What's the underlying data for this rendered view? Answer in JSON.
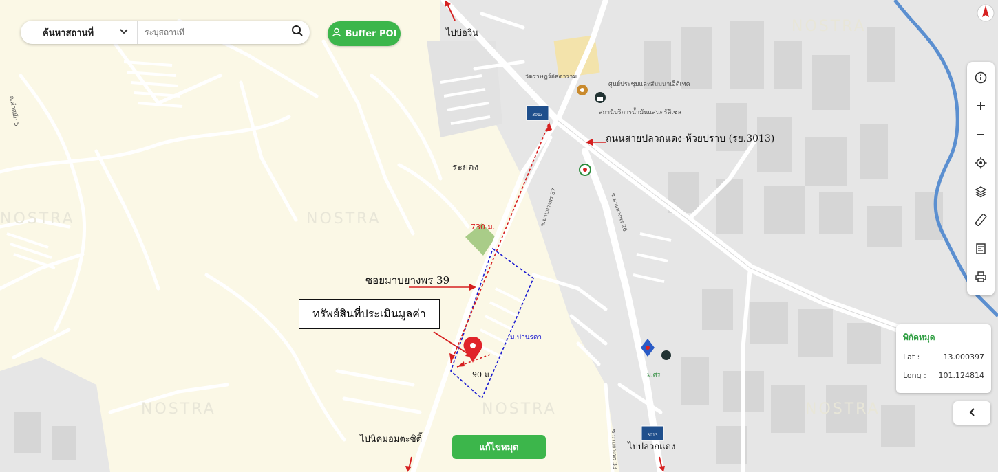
{
  "search": {
    "category_label": "ค้นหาสถานที่",
    "placeholder": "ระบุสถานที่"
  },
  "buffer_button": {
    "label": "Buffer POI"
  },
  "map_labels": {
    "to_bowin": "ไปบ่อวิน",
    "temple": "วัดราษฎร์อัสดาราม",
    "conference_center": "ศูนย์ประชุมและสัมมนาเอ็ดีเทค",
    "diesel_station": "สถานีบริการน้ำมันแสนตรัดีเซล",
    "road_main": "ถนนสายปลวกแดง-ห้วยปราบ (รย.3013)",
    "rayong": "ระยอง",
    "distance_730": "730 ม.",
    "soi_label": "ซอยมาบยางพร 39",
    "distance_90": "90 ม.",
    "village": "ม.ปานรดา",
    "to_industrial": "ไปนิคมอมตะซิตี้",
    "to_pluakdaeng": "ไปปลวกแดง",
    "road_left": "ถ.คำสมัก 5",
    "soi_vertical": "ซ.มาบยางพร 37",
    "soi_vertical2": "ซ.มาบยางพร 26",
    "soi_bottom": "ซ.มาบยางพร 33",
    "mpa": "ม.ศร",
    "route_shield": "3013",
    "watermark": "NOSTRA"
  },
  "annotation": {
    "asset_label": "ทรัพย์สินที่ประเมินมูลค่า"
  },
  "coordinates": {
    "title": "พิกัดหมุด",
    "lat_label": "Lat :",
    "lat_value": "13.000397",
    "long_label": "Long :",
    "long_value": "101.124814"
  },
  "edit_button": {
    "label": "แก้ไขหมุด"
  },
  "toolbar": {
    "tools": [
      "info-icon",
      "zoom-in-icon",
      "zoom-out-icon",
      "locate-icon",
      "layers-icon",
      "ruler-icon",
      "map-export-icon",
      "print-icon"
    ]
  },
  "colors": {
    "background": "#fbf8e6",
    "road": "#ffffff",
    "built_area": "#e4e4e4",
    "river": "#5b8fd0",
    "green_button": "#3cb64b",
    "annotation_red": "#d62020",
    "buffer_blue": "#1a1ad0"
  }
}
